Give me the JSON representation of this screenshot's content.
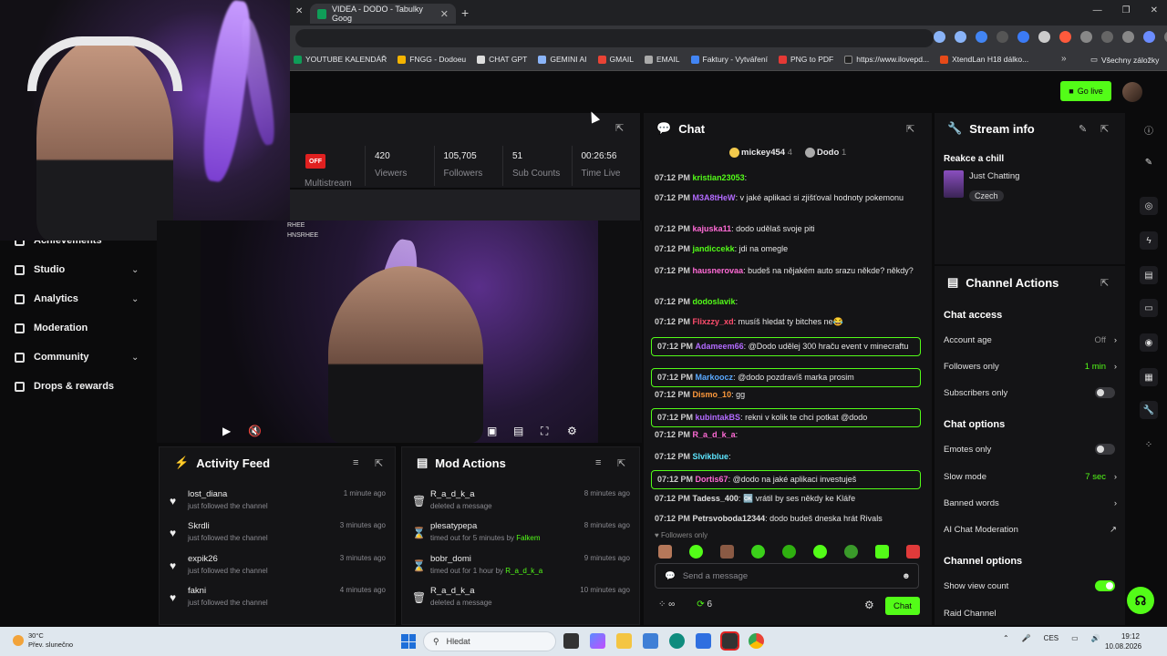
{
  "browser": {
    "tab_title": "VIDEA - DODO - Tabulky Goog",
    "bookmarks": [
      "YOUTUBE KALENDÁŘ",
      "FNGG - Dodoeu",
      "CHAT GPT",
      "GEMINI AI",
      "GMAIL",
      "EMAIL",
      "Faktury - Vytváření",
      "PNG to PDF",
      "https://www.ilovepd...",
      "XtendLan H18 dálko..."
    ],
    "all_bookmarks": "Všechny záložky"
  },
  "header": {
    "go_live": "Go live"
  },
  "nav": {
    "items": [
      {
        "label": "Achievements"
      },
      {
        "label": "Studio"
      },
      {
        "label": "Analytics"
      },
      {
        "label": "Moderation"
      },
      {
        "label": "Community"
      },
      {
        "label": "Drops & rewards"
      }
    ]
  },
  "stats": {
    "status": "OFF",
    "multistream": "Multistream",
    "items": [
      {
        "value": "420",
        "label": "Viewers"
      },
      {
        "value": "105,705",
        "label": "Followers"
      },
      {
        "value": "51",
        "label": "Sub Counts"
      },
      {
        "value": "00:26:56",
        "label": "Time Live"
      }
    ]
  },
  "preview": {
    "overlay_line1": "RHEE",
    "overlay_line2": "HNSRHEE"
  },
  "activity": {
    "title": "Activity Feed",
    "items": [
      {
        "name": "lost_diana",
        "sub": "just followed the channel",
        "time": "1 minute ago"
      },
      {
        "name": "Skrdli",
        "sub": "just followed the channel",
        "time": "3 minutes ago"
      },
      {
        "name": "expik26",
        "sub": "just followed the channel",
        "time": "3 minutes ago"
      },
      {
        "name": "fakni",
        "sub": "just followed the channel",
        "time": "4 minutes ago"
      }
    ]
  },
  "mod": {
    "title": "Mod Actions",
    "items": [
      {
        "name": "R_a_d_k_a",
        "sub": "deleted a message",
        "by": "",
        "time": "8 minutes ago"
      },
      {
        "name": "plesatypepa",
        "sub": "timed out for 5 minutes by ",
        "by": "Falkem",
        "time": "8 minutes ago"
      },
      {
        "name": "bobr_domi",
        "sub": "timed out for 1 hour by ",
        "by": "R_a_d_k_a",
        "time": "9 minutes ago"
      },
      {
        "name": "R_a_d_k_a",
        "sub": "deleted a message",
        "by": "",
        "time": "10 minutes ago"
      }
    ]
  },
  "chat": {
    "title": "Chat",
    "top1": "mickey454",
    "top1n": "4",
    "top2": "Dodo",
    "top2n": "1",
    "messages": [
      {
        "time": "07:12 PM",
        "user": "kristian23053",
        "color": "#53fc18",
        "text": ""
      },
      {
        "time": "07:12 PM",
        "user": "M3A8tHeW",
        "color": "#b36bff",
        "text": "v jaké aplikaci si zjišťoval hodnoty pokemonu"
      },
      {
        "time": "07:12 PM",
        "user": "kajuska11",
        "color": "#ff6bd6",
        "text": "dodo udělaš svoje piti"
      },
      {
        "time": "07:12 PM",
        "user": "jandiccekk",
        "color": "#53fc18",
        "text": "jdi na omegle"
      },
      {
        "time": "07:12 PM",
        "user": "hausnerovaa",
        "color": "#ff6bd6",
        "text": "budeš na nějakém auto srazu někde? někdy?"
      },
      {
        "time": "07:12 PM",
        "user": "dodoslavik",
        "color": "#53fc18",
        "text": ""
      },
      {
        "time": "07:12 PM",
        "user": "Flixzzy_xd",
        "color": "#ff4d6d",
        "text": "musíš hledat ty bitches ne😂"
      },
      {
        "time": "07:12 PM",
        "user": "Adameem66",
        "color": "#b36bff",
        "text": "@Dodo udělej 300 hraču event v minecraftu"
      },
      {
        "time": "07:12 PM",
        "user": "Markoocz",
        "color": "#5aa9ff",
        "text": "@dodo pozdravíš marka prosim"
      },
      {
        "time": "07:12 PM",
        "user": "Dismo_10",
        "color": "#ff9a3c",
        "text": "gg"
      },
      {
        "time": "07:12 PM",
        "user": "kubintakBS",
        "color": "#b36bff",
        "text": "rekni v kolik te chci potkat @dodo"
      },
      {
        "time": "07:12 PM",
        "user": "R_a_d_k_a",
        "color": "#ff6bd6",
        "text": ""
      },
      {
        "time": "07:12 PM",
        "user": "Slvikblue",
        "color": "#5ee6ff",
        "text": ""
      },
      {
        "time": "07:12 PM",
        "user": "Dortis67",
        "color": "#ff6bd6",
        "text": "@dodo na jaké aplikaci investuješ"
      },
      {
        "time": "07:12 PM",
        "user": "Tadess_400",
        "color": "#e0e0e0",
        "text": "🆗 vrátil by ses někdy ke Kláře"
      },
      {
        "time": "07:12 PM",
        "user": "Petrsvoboda12344",
        "color": "#e0e0e0",
        "text": "dodo budeš dneska hrát Rivals"
      }
    ],
    "followers_only": "Followers only",
    "placeholder": "Send a message",
    "count": "6",
    "send": "Chat"
  },
  "stream_info": {
    "title": "Stream info",
    "stream_title": "Reakce a chill",
    "category": "Just Chatting",
    "language": "Czech"
  },
  "channel_actions": {
    "title": "Channel Actions",
    "chat_access": "Chat access",
    "account_age": "Account age",
    "account_age_val": "Off",
    "followers_only": "Followers only",
    "followers_only_val": "1 min",
    "subscribers_only": "Subscribers only",
    "chat_options": "Chat options",
    "emotes_only": "Emotes only",
    "slow_mode": "Slow mode",
    "slow_mode_val": "7 sec",
    "banned_words": "Banned words",
    "ai_mod": "AI Chat Moderation",
    "channel_options": "Channel options",
    "show_view_count": "Show view count",
    "raid": "Raid Channel"
  },
  "taskbar": {
    "temp": "30°C",
    "weather": "Přev. slunečno",
    "search": "Hledat",
    "lang": "CES",
    "time": "19:12",
    "date": "10.08.2026"
  }
}
